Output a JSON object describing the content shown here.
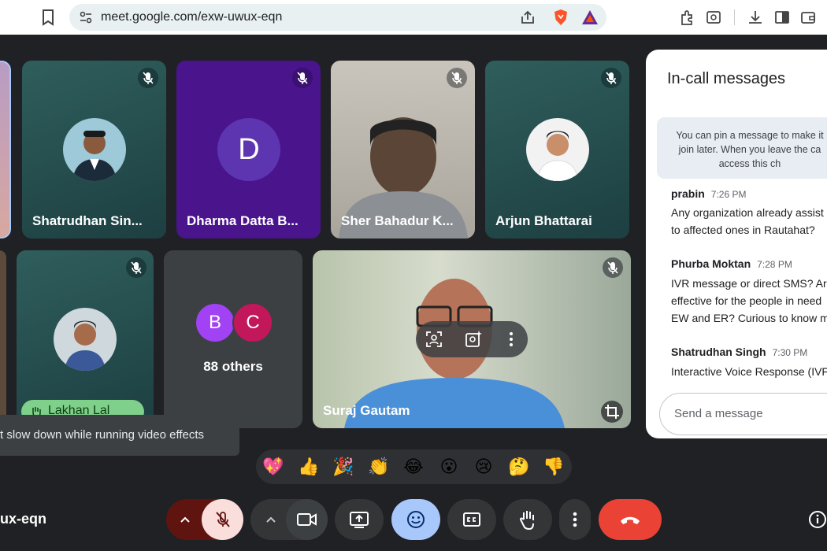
{
  "browser": {
    "url": "meet.google.com/exw-uwux-eqn"
  },
  "participants": {
    "p1_name": "Shatrudhan Sin...",
    "p2_name": "Dharma Datta B...",
    "p2_initial": "D",
    "p3_name": "Sher Bahadur K...",
    "p4_name": "Arjun Bhattarai",
    "p5_name": "Lakhan Lal",
    "others_initials": [
      "B",
      "C"
    ],
    "others_count": "88 others",
    "presenter_name": "Suraj Gautam"
  },
  "chat_panel": {
    "title": "In-call messages",
    "pin_note": [
      "You can pin a message to make it",
      "join later. When you leave the ca",
      "access this ch"
    ],
    "messages": [
      {
        "sender": "prabin",
        "time": "7:26 PM",
        "lines": [
          "Any organization already assist",
          "to affected ones in Rautahat?"
        ]
      },
      {
        "sender": "Phurba Moktan",
        "time": "7:28 PM",
        "lines": [
          "IVR message or direct SMS? Ar",
          "effective for the people in need",
          "EW and ER? Curious to know m"
        ]
      },
      {
        "sender": "Shatrudhan Singh",
        "time": "7:30 PM",
        "lines": [
          "Interactive Voice Response (IVF"
        ]
      }
    ],
    "input_placeholder": "Send a message"
  },
  "tooltip": "t slow down while running video effects",
  "reactions": [
    "💖",
    "👍",
    "🎉",
    "👏",
    "😂",
    "😮",
    "😢",
    "🤔",
    "👎"
  ],
  "bottom": {
    "meeting_code": "ux-eqn"
  },
  "colors": {
    "hangup": "#ea4335",
    "mic_off_bg": "#f9dedc",
    "emoji_btn": "#a8c7fa",
    "tile_teal": "#1e4c4c",
    "tile_purple": "#4a148c"
  }
}
